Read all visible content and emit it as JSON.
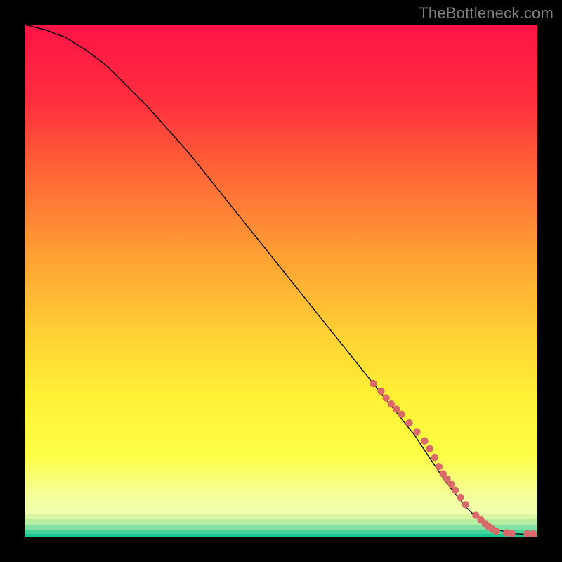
{
  "watermark": "TheBottleneck.com",
  "chart_data": {
    "type": "line",
    "title": "",
    "xlabel": "",
    "ylabel": "",
    "xlim": [
      0,
      100
    ],
    "ylim": [
      0,
      100
    ],
    "series": [
      {
        "name": "curve",
        "x": [
          0,
          4,
          8,
          12,
          16,
          20,
          24,
          28,
          32,
          36,
          40,
          44,
          48,
          52,
          56,
          60,
          64,
          68,
          72,
          76,
          80,
          82,
          84,
          86,
          88,
          90,
          92,
          94,
          96,
          98,
          100
        ],
        "y": [
          100,
          99,
          97.5,
          95,
          92,
          88,
          84,
          79.5,
          75,
          70,
          65,
          60,
          55,
          50,
          45,
          40,
          35,
          30,
          25,
          20,
          14,
          11,
          8.5,
          6,
          4,
          2.6,
          1.6,
          1.0,
          0.7,
          0.6,
          0.6
        ],
        "stroke": "#000000",
        "stroke_width": 1.4
      }
    ],
    "markers": {
      "name": "sampled-points",
      "color": "#d86a6a",
      "radius": 5.2,
      "x": [
        68,
        69.5,
        70.5,
        71.5,
        72.5,
        73.5,
        75,
        76.5,
        78,
        79,
        80,
        80.8,
        81.6,
        82.4,
        83.2,
        84,
        85,
        86,
        88,
        89,
        89.8,
        90.5,
        91.2,
        92,
        94,
        95,
        98,
        99.2
      ],
      "y": [
        30,
        28.5,
        27.2,
        26,
        25,
        24,
        22.3,
        20.6,
        18.8,
        17.3,
        15.6,
        13.8,
        12.4,
        11.4,
        10.4,
        9.2,
        7.8,
        6.4,
        4.3,
        3.4,
        2.7,
        2.1,
        1.6,
        1.2,
        0.9,
        0.8,
        0.7,
        0.7
      ]
    },
    "background": {
      "type": "vertical-gradient",
      "stops": [
        {
          "pos": 0.0,
          "color": "#ff1347"
        },
        {
          "pos": 0.15,
          "color": "#ff2f3e"
        },
        {
          "pos": 0.3,
          "color": "#ff6a36"
        },
        {
          "pos": 0.45,
          "color": "#ffa034"
        },
        {
          "pos": 0.6,
          "color": "#ffd034"
        },
        {
          "pos": 0.72,
          "color": "#fff035"
        },
        {
          "pos": 0.84,
          "color": "#fdff46"
        },
        {
          "pos": 0.92,
          "color": "#f4ff9d"
        },
        {
          "pos": 1.0,
          "color": "#eaffca"
        }
      ],
      "bottom_bands": [
        {
          "from": 0.955,
          "to": 0.965,
          "color": "#d9f7a2"
        },
        {
          "from": 0.965,
          "to": 0.975,
          "color": "#b7ee9f"
        },
        {
          "from": 0.975,
          "to": 0.985,
          "color": "#82e1a0"
        },
        {
          "from": 0.985,
          "to": 0.993,
          "color": "#45d39c"
        },
        {
          "from": 0.993,
          "to": 1.0,
          "color": "#18c993"
        }
      ]
    }
  }
}
